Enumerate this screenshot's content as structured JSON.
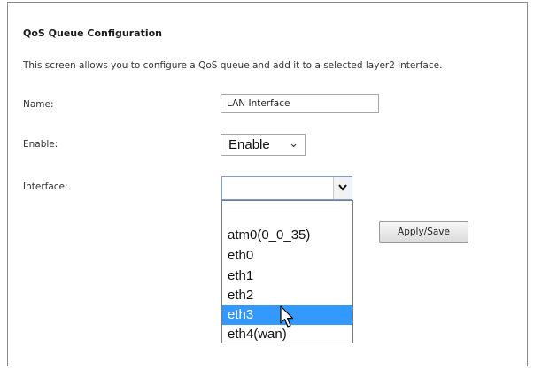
{
  "form": {
    "title": "QoS Queue Configuration",
    "description": "This screen allows you to configure a QoS queue and add it to a selected layer2 interface.",
    "name_label": "Name:",
    "name_value": "LAN Interface",
    "enable_label": "Enable:",
    "enable_value": "Enable",
    "interface_label": "Interface:",
    "interface_value": "",
    "apply_label": "Apply/Save"
  },
  "interface_dropdown": {
    "options": [
      "",
      "atm0(0_0_35)",
      "eth0",
      "eth1",
      "eth2",
      "eth3",
      "eth4(wan)"
    ],
    "highlighted": "eth3"
  },
  "icons": {
    "enable_chevron": "chevron-down-icon",
    "interface_chevron": "chevron-down-icon",
    "cursor": "mouse-pointer-icon"
  },
  "colors": {
    "highlight": "#3399ff",
    "border": "#8a8a8a"
  }
}
